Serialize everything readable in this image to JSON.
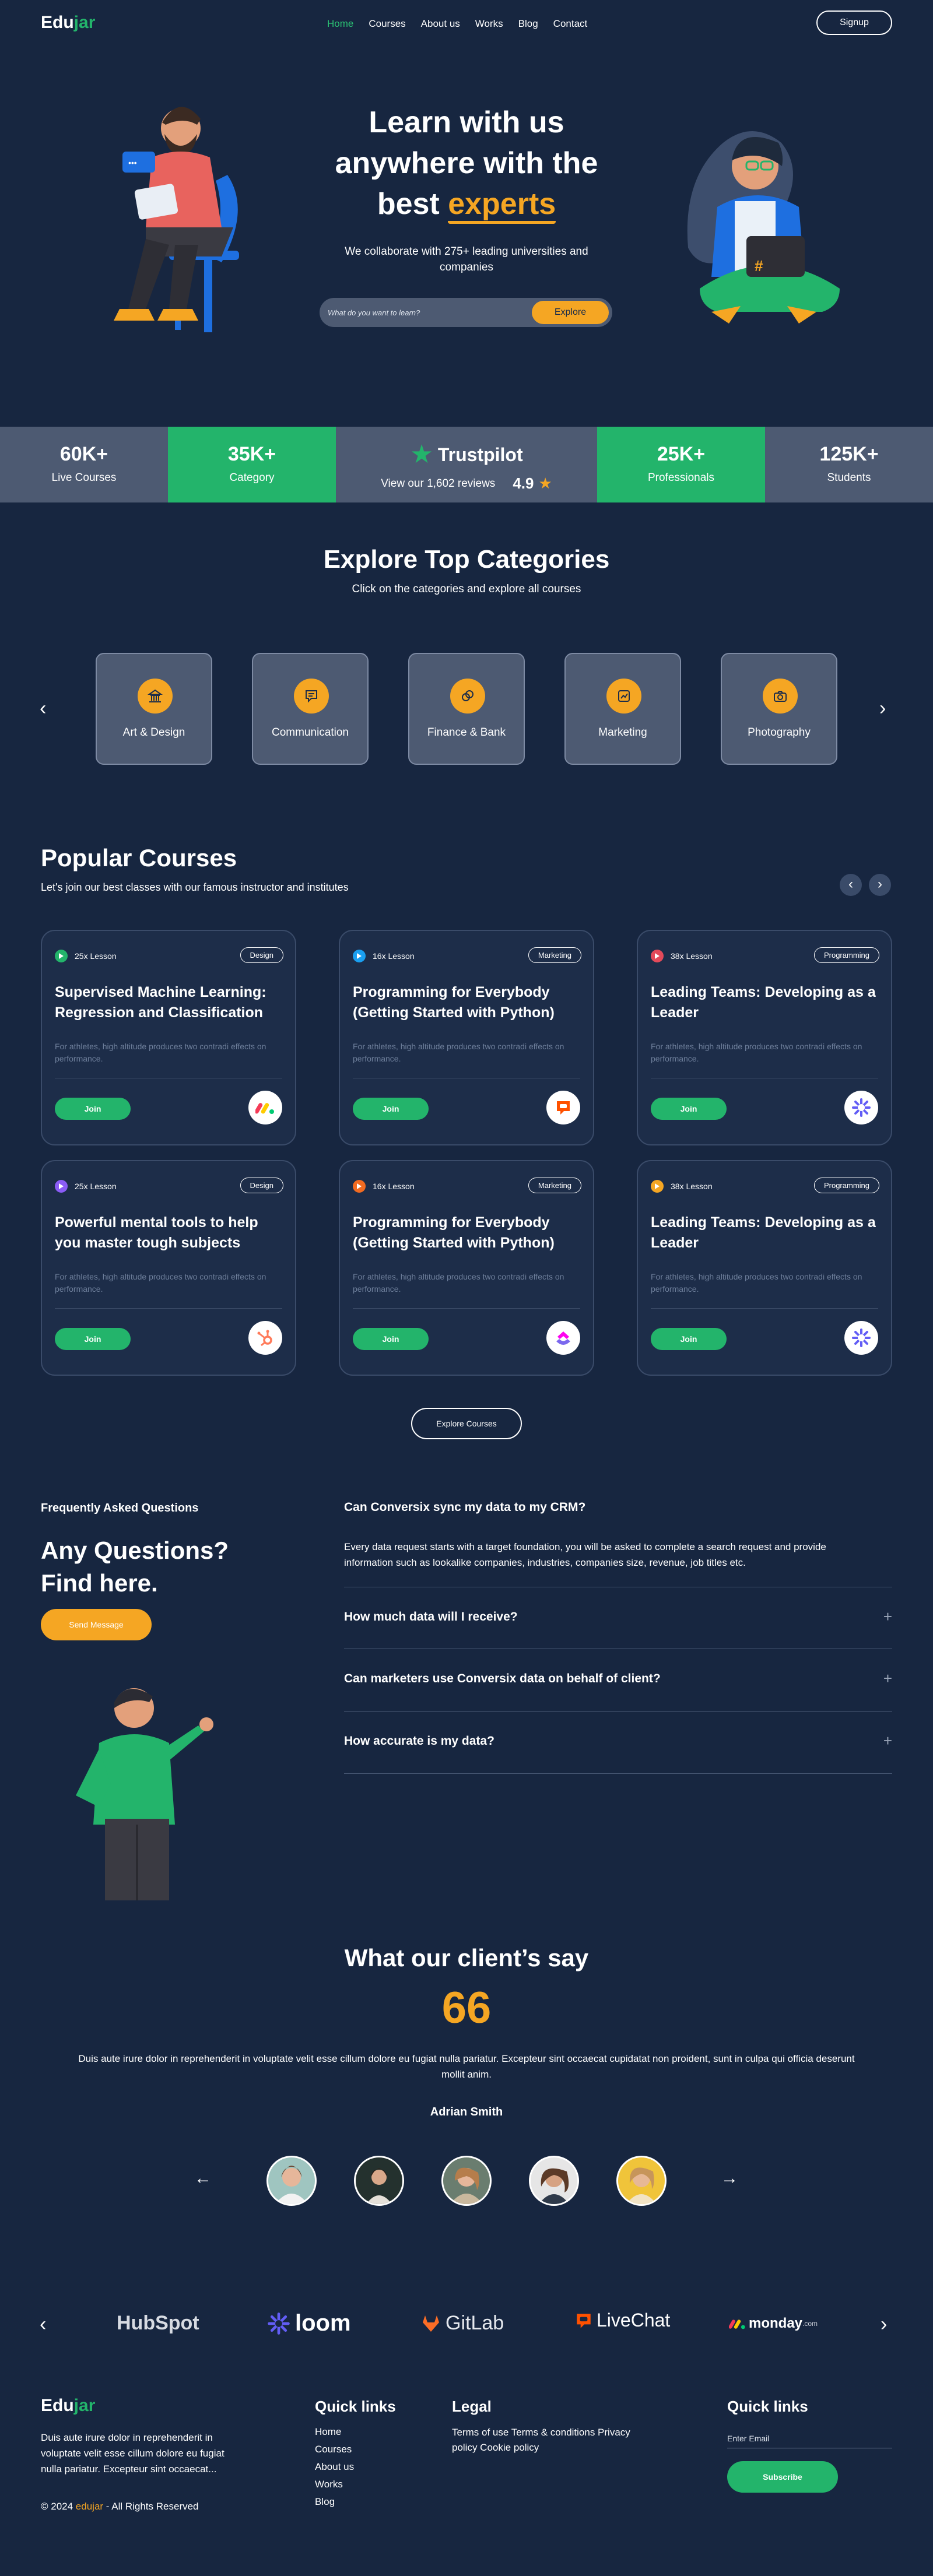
{
  "brand": {
    "name_part1": "Edu",
    "name_part2": "jar"
  },
  "nav": {
    "items": [
      {
        "label": "Home",
        "active": true
      },
      {
        "label": "Courses"
      },
      {
        "label": "About us"
      },
      {
        "label": "Works"
      },
      {
        "label": "Blog"
      },
      {
        "label": "Contact"
      }
    ],
    "signup": "Signup"
  },
  "hero": {
    "title_line1": "Learn with us",
    "title_line2": "anywhere with the",
    "title_line3_plain": "best ",
    "title_line3_accent": "experts",
    "subtitle_line1": "We collaborate with 275+ leading universities and",
    "subtitle_line2": "companies",
    "search_placeholder": "What do you want to learn?",
    "search_button": "Explore",
    "laptop_symbol": "#"
  },
  "stats": [
    {
      "num": "60K+",
      "label": "Live Courses"
    },
    {
      "num": "35K+",
      "label": "Category"
    },
    {
      "num": "25K+",
      "label": "Professionals"
    },
    {
      "num": "125K+",
      "label": "Students"
    }
  ],
  "trustpilot": {
    "name": "Trustpilot",
    "reviews": "View our 1,602 reviews",
    "rating": "4.9"
  },
  "categories": {
    "title": "Explore Top Categories",
    "subtitle": "Click on the categories and explore all courses",
    "items": [
      {
        "label": "Art & Design",
        "icon": "bank-icon"
      },
      {
        "label": "Communication",
        "icon": "chat-icon"
      },
      {
        "label": "Finance & Bank",
        "icon": "coins-icon"
      },
      {
        "label": "Marketing",
        "icon": "chart-icon"
      },
      {
        "label": "Photography",
        "icon": "camera-icon"
      }
    ]
  },
  "courses": {
    "title": "Popular Courses",
    "subtitle": "Let's join our best classes with our famous instructor and institutes",
    "explore_button": "Explore Courses",
    "join_label": "Join",
    "desc": "For athletes, high altitude produces two contradi effects on performance.",
    "items": [
      {
        "lessons": "25x Lesson",
        "tag": "Design",
        "title": "Supervised Machine Learning: Regression and Classification",
        "dot_color": "#23b46b",
        "logo": "monday-logo"
      },
      {
        "lessons": "16x Lesson",
        "tag": "Marketing",
        "title": "Programming for Everybody (Getting Started with Python)",
        "dot_color": "#1a9ff0",
        "logo": "livechat-logo"
      },
      {
        "lessons": "38x Lesson",
        "tag": "Programming",
        "title": "Leading Teams: Developing as a Leader",
        "dot_color": "#e34a5a",
        "logo": "loom-logo"
      },
      {
        "lessons": "25x Lesson",
        "tag": "Design",
        "title": "Powerful mental tools to help you master tough subjects",
        "dot_color": "#8b5cf6",
        "logo": "hubspot-logo"
      },
      {
        "lessons": "16x Lesson",
        "tag": "Marketing",
        "title": "Programming for Everybody (Getting Started with Python)",
        "dot_color": "#f26b21",
        "logo": "clickup-logo"
      },
      {
        "lessons": "38x Lesson",
        "tag": "Programming",
        "title": "Leading Teams: Developing as a Leader",
        "dot_color": "#f5a623",
        "logo": "loom-logo"
      }
    ]
  },
  "faq": {
    "label": "Frequently Asked Questions",
    "heading_line1": "Any Questions?",
    "heading_line2": "Find here.",
    "send_button": "Send Message",
    "items": [
      {
        "q": "Can Conversix sync my data to my CRM?",
        "a": "Every data request starts with a target foundation, you will be asked to complete a search request and provide information such as lookalike companies, industries, companies size, revenue, job titles etc."
      },
      {
        "q": "How much data will I receive?"
      },
      {
        "q": "Can marketers use Conversix data on behalf of client?"
      },
      {
        "q": "How accurate is my data?"
      }
    ]
  },
  "testimonial": {
    "title": "What our client’s say",
    "quote_mark": "66",
    "text": "Duis aute irure dolor in reprehenderit in voluptate velit esse cillum dolore eu fugiat nulla pariatur. Excepteur sint occaecat cupidatat non proident, sunt in culpa qui officia deserunt mollit anim.",
    "name": "Adrian Smith"
  },
  "partners": [
    "HubSpot",
    "loom",
    "GitLab",
    "LiveChat",
    "monday"
  ],
  "partner_suffix": ".com",
  "footer": {
    "about": "Duis aute irure dolor in reprehenderit in voluptate velit esse cillum dolore eu fugiat nulla pariatur. Excepteur sint occaecat...",
    "copyright_prefix": "© 2024 ",
    "copyright_brand": "edujar",
    "copyright_suffix": " - All Rights Reserved",
    "quick_links_title": "Quick links",
    "quick_links": [
      "Home",
      "Courses",
      "About us",
      "Works",
      "Blog"
    ],
    "legal_title": "Legal",
    "legal_text": "Terms of use Terms & conditions Privacy policy Cookie policy",
    "newsletter_title": "Quick links",
    "email_placeholder": "Enter Email",
    "subscribe": "Subscribe"
  },
  "colors": {
    "bg": "#172640",
    "green": "#23b46b",
    "orange": "#f5a623",
    "stat_gray": "#4d5a72"
  }
}
